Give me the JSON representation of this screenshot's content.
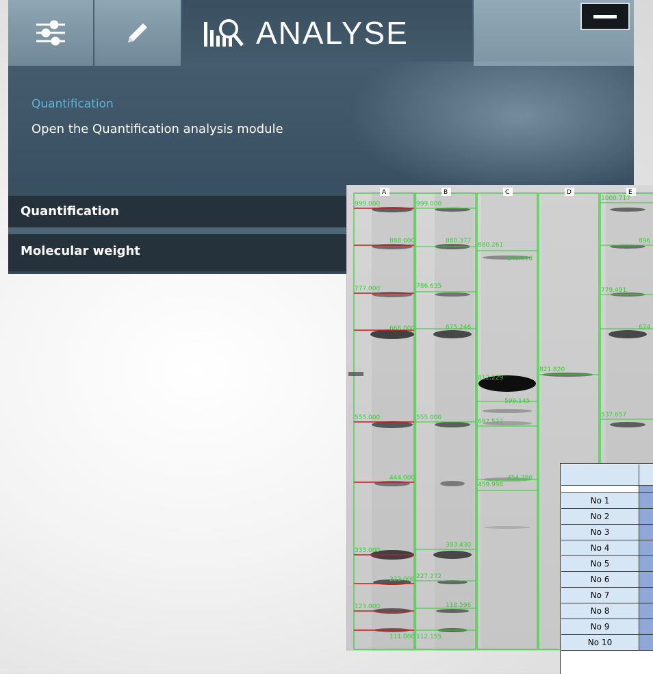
{
  "header": {
    "tabs": [
      {
        "icon": "sliders-icon"
      },
      {
        "icon": "pencil-icon"
      },
      {
        "icon": "analyse-icon",
        "label": "ANALYSE"
      }
    ],
    "minimize_icon": "minimize-icon"
  },
  "description": {
    "title": "Quantification",
    "text": "Open the Quantification analysis module"
  },
  "menu": {
    "items": [
      {
        "label": "Quantification"
      },
      {
        "label": "Molecular weight"
      }
    ]
  },
  "gel": {
    "lanes": [
      "A",
      "B",
      "C",
      "D",
      "E"
    ],
    "band_labels": [
      "999.000",
      "888.000",
      "777.000",
      "666.000",
      "555.000",
      "444.000",
      "333.000",
      "222.000",
      "123.000",
      "111.000",
      "999.000",
      "880.377",
      "786.635",
      "675.246",
      "555.000",
      "393.430",
      "227.272",
      "118.596",
      "112.155",
      "880.261",
      "849.818",
      "812.229",
      "599.145",
      "697.527",
      "459.998",
      "454.286",
      "821.820",
      "1000.717",
      "896",
      "779.491",
      "674",
      "537.657"
    ]
  },
  "table": {
    "rows": [
      "No 1",
      "No 2",
      "No 3",
      "No 4",
      "No 5",
      "No 6",
      "No 7",
      "No 8",
      "No 9",
      "No 10"
    ]
  },
  "colors": {
    "panel": "#3b5264",
    "accent_title": "#5fb3d6",
    "menu_bg": "#26323b",
    "gel_green": "#27d427",
    "gel_red": "#d01818",
    "table_header": "#d7e6f5",
    "table_value": "#8fa8d8"
  }
}
